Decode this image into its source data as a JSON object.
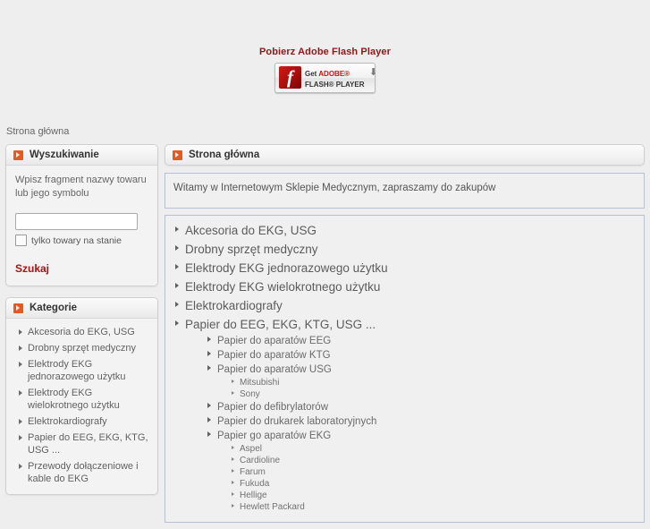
{
  "flash_promo": {
    "title": "Pobierz Adobe Flash Player",
    "badge_line1_prefix": "Get ",
    "badge_line1_brand": "ADOBE®",
    "badge_line2": "FLASH® PLAYER",
    "download_arrow": "⬇",
    "flash_glyph": "f"
  },
  "breadcrumb": {
    "current": "Strona główna"
  },
  "sidebar": {
    "search_panel": {
      "title": "Wyszukiwanie",
      "hint": "Wpisz fragment nazwy towaru lub jego symbolu",
      "input_value": "",
      "input_placeholder": "",
      "checkbox_label": "tylko towary na stanie",
      "checkbox_checked": false,
      "submit_label": "Szukaj"
    },
    "categories_panel": {
      "title": "Kategorie",
      "items": [
        {
          "label": "Akcesoria do EKG, USG"
        },
        {
          "label": "Drobny sprzęt medyczny"
        },
        {
          "label": "Elektrody EKG jednorazowego użytku"
        },
        {
          "label": "Elektrody EKG wielokrotnego użytku"
        },
        {
          "label": "Elektrokardiografy"
        },
        {
          "label": "Papier do EEG, EKG, KTG, USG ..."
        },
        {
          "label": "Przewody dołączeniowe i kable do EKG"
        }
      ]
    }
  },
  "content": {
    "page_title": "Strona główna",
    "welcome_text": "Witamy w Internetowym Sklepie Medycznym, zapraszamy do zakupów",
    "tree": [
      {
        "level": 1,
        "label": "Akcesoria do EKG, USG"
      },
      {
        "level": 1,
        "label": "Drobny sprzęt medyczny"
      },
      {
        "level": 1,
        "label": "Elektrody EKG jednorazowego użytku"
      },
      {
        "level": 1,
        "label": "Elektrody EKG wielokrotnego użytku"
      },
      {
        "level": 1,
        "label": "Elektrokardiografy"
      },
      {
        "level": 1,
        "label": "Papier do EEG, EKG, KTG, USG ..."
      },
      {
        "level": 2,
        "label": "Papier do aparatów EEG"
      },
      {
        "level": 2,
        "label": "Papier do aparatów KTG"
      },
      {
        "level": 2,
        "label": "Papier do aparatów USG"
      },
      {
        "level": 3,
        "label": "Mitsubishi"
      },
      {
        "level": 3,
        "label": "Sony"
      },
      {
        "level": 2,
        "label": "Papier do defibrylatorów"
      },
      {
        "level": 2,
        "label": "Papier do drukarek laboratoryjnych"
      },
      {
        "level": 2,
        "label": "Papier go aparatów EKG"
      },
      {
        "level": 3,
        "label": "Aspel"
      },
      {
        "level": 3,
        "label": "Cardioline"
      },
      {
        "level": 3,
        "label": "Farum"
      },
      {
        "level": 3,
        "label": "Fukuda"
      },
      {
        "level": 3,
        "label": "Hellige"
      },
      {
        "level": 3,
        "label": "Hewlett Packard"
      }
    ]
  },
  "colors": {
    "page_background": "#eeeeee",
    "accent_orange": "#e35b20",
    "link_red": "#a81313",
    "promo_red": "#8f1717",
    "panel_border": "#b8bfd0",
    "box_border": "#cfcfcf"
  }
}
